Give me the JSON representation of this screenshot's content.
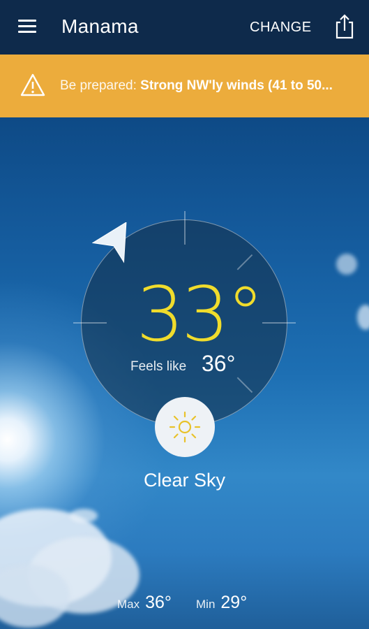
{
  "header": {
    "title": "Manama",
    "change_label": "CHANGE"
  },
  "alert": {
    "prefix": "Be prepared:",
    "message": "Strong NW'ly winds (41 to 50..."
  },
  "weather": {
    "temperature": "33°",
    "feels_like_label": "Feels like",
    "feels_like_value": "36°",
    "condition": "Clear Sky",
    "max_label": "Max",
    "max_value": "36°",
    "min_label": "Min",
    "min_value": "29°"
  },
  "icons": {
    "menu": "hamburger-menu-icon",
    "share": "share-icon",
    "alert": "warning-triangle-icon",
    "wind": "wind-direction-arrow-icon",
    "condition": "sun-icon"
  },
  "colors": {
    "header_bg": "#0e2a4b",
    "alert_bg": "#ecac3c",
    "temperature": "#f0dc2c",
    "sun_icon": "#e8c22a"
  }
}
